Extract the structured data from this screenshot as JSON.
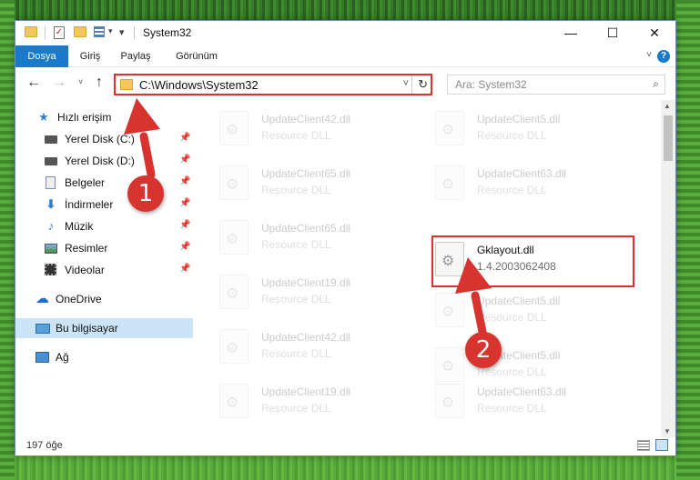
{
  "window": {
    "title": "System32",
    "controls": {
      "minimize": "—",
      "maximize": "☐",
      "close": "✕"
    }
  },
  "ribbon": {
    "tabs": [
      "Dosya",
      "Giriş",
      "Paylaş",
      "Görünüm"
    ],
    "expand_caret": "˅",
    "help": "?"
  },
  "navigation": {
    "back": "←",
    "forward": "→",
    "up": "↑",
    "recent_caret": "˅",
    "address": "C:\\Windows\\System32",
    "address_dropdown": "˅",
    "refresh": "↻",
    "search_placeholder": "Ara: System32"
  },
  "sidebar": {
    "items": [
      {
        "label": "Hızlı erişim",
        "icon": "star-icon",
        "pinned": false
      },
      {
        "label": "Yerel Disk (C:)",
        "icon": "drive-icon",
        "pinned": true
      },
      {
        "label": "Yerel Disk (D:)",
        "icon": "drive-icon",
        "pinned": true
      },
      {
        "label": "Belgeler",
        "icon": "documents-icon",
        "pinned": true
      },
      {
        "label": "İndirmeler",
        "icon": "download-icon",
        "pinned": true
      },
      {
        "label": "Müzik",
        "icon": "music-icon",
        "pinned": true
      },
      {
        "label": "Resimler",
        "icon": "pictures-icon",
        "pinned": true
      },
      {
        "label": "Videolar",
        "icon": "videos-icon",
        "pinned": true
      },
      {
        "label": "OneDrive",
        "icon": "cloud-icon",
        "pinned": false
      },
      {
        "label": "Bu bilgisayar",
        "icon": "computer-icon",
        "pinned": false,
        "selected": true
      },
      {
        "label": "Ağ",
        "icon": "network-icon",
        "pinned": false
      }
    ],
    "pin_glyph": "📌"
  },
  "files": [
    {
      "name": "UpdateClient42.dll",
      "type": "Resource DLL"
    },
    {
      "name": "UpdateClient5.dll",
      "type": "Resource DLL"
    },
    {
      "name": "UpdateClient65.dll",
      "type": "Resource DLL"
    },
    {
      "name": "UpdateClient63.dll",
      "type": "Resource DLL"
    },
    {
      "name": "UpdateClient65.dll",
      "type": "Resource DLL"
    },
    {
      "name": "Gklayout.dll",
      "type": "1.4.2003062408",
      "highlighted": true
    },
    {
      "name": "UpdateClient19.dll",
      "type": "Resource DLL"
    },
    {
      "name": "UpdateClient5.dll",
      "type": "Resource DLL"
    },
    {
      "name": "UpdateClient42.dll",
      "type": "Resource DLL"
    },
    {
      "name": "UpdateClient5.dll",
      "type": "Resource DLL"
    },
    {
      "name": "UpdateClient19.dll",
      "type": "Resource DLL"
    },
    {
      "name": "UpdateClient63.dll",
      "type": "Resource DLL"
    }
  ],
  "statusbar": {
    "item_count": "197 öğe"
  },
  "annotations": {
    "step1": "1",
    "step2": "2",
    "accent": "#d8342f"
  }
}
